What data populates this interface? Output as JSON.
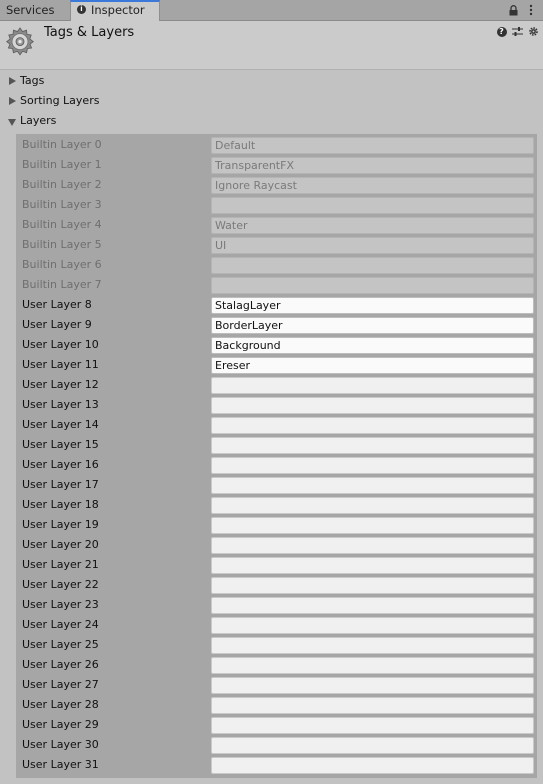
{
  "tabs": {
    "services": "Services",
    "inspector": "Inspector"
  },
  "header": {
    "title": "Tags & Layers"
  },
  "sections": {
    "tags": "Tags",
    "sorting_layers": "Sorting Layers",
    "layers": "Layers"
  },
  "layers": [
    {
      "label": "Builtin Layer 0",
      "value": "Default",
      "builtin": true
    },
    {
      "label": "Builtin Layer 1",
      "value": "TransparentFX",
      "builtin": true
    },
    {
      "label": "Builtin Layer 2",
      "value": "Ignore Raycast",
      "builtin": true
    },
    {
      "label": "Builtin Layer 3",
      "value": "",
      "builtin": true
    },
    {
      "label": "Builtin Layer 4",
      "value": "Water",
      "builtin": true
    },
    {
      "label": "Builtin Layer 5",
      "value": "UI",
      "builtin": true
    },
    {
      "label": "Builtin Layer 6",
      "value": "",
      "builtin": true
    },
    {
      "label": "Builtin Layer 7",
      "value": "",
      "builtin": true
    },
    {
      "label": "User Layer 8",
      "value": "StalagLayer",
      "builtin": false
    },
    {
      "label": "User Layer 9",
      "value": "BorderLayer",
      "builtin": false
    },
    {
      "label": "User Layer 10",
      "value": "Background",
      "builtin": false
    },
    {
      "label": "User Layer 11",
      "value": "Ereser",
      "builtin": false
    },
    {
      "label": "User Layer 12",
      "value": "",
      "builtin": false
    },
    {
      "label": "User Layer 13",
      "value": "",
      "builtin": false
    },
    {
      "label": "User Layer 14",
      "value": "",
      "builtin": false
    },
    {
      "label": "User Layer 15",
      "value": "",
      "builtin": false
    },
    {
      "label": "User Layer 16",
      "value": "",
      "builtin": false
    },
    {
      "label": "User Layer 17",
      "value": "",
      "builtin": false
    },
    {
      "label": "User Layer 18",
      "value": "",
      "builtin": false
    },
    {
      "label": "User Layer 19",
      "value": "",
      "builtin": false
    },
    {
      "label": "User Layer 20",
      "value": "",
      "builtin": false
    },
    {
      "label": "User Layer 21",
      "value": "",
      "builtin": false
    },
    {
      "label": "User Layer 22",
      "value": "",
      "builtin": false
    },
    {
      "label": "User Layer 23",
      "value": "",
      "builtin": false
    },
    {
      "label": "User Layer 24",
      "value": "",
      "builtin": false
    },
    {
      "label": "User Layer 25",
      "value": "",
      "builtin": false
    },
    {
      "label": "User Layer 26",
      "value": "",
      "builtin": false
    },
    {
      "label": "User Layer 27",
      "value": "",
      "builtin": false
    },
    {
      "label": "User Layer 28",
      "value": "",
      "builtin": false
    },
    {
      "label": "User Layer 29",
      "value": "",
      "builtin": false
    },
    {
      "label": "User Layer 30",
      "value": "",
      "builtin": false
    },
    {
      "label": "User Layer 31",
      "value": "",
      "builtin": false
    }
  ],
  "icons": {
    "tab_info": "info-icon",
    "lock": "lock-icon",
    "tab_menu": "kebab-menu-icon",
    "settings_asset": "gear-icon",
    "help": "help-icon",
    "presets": "sliders-icon",
    "settings": "settings-icon"
  },
  "colors": {
    "accent_tab": "#3a79d9"
  }
}
